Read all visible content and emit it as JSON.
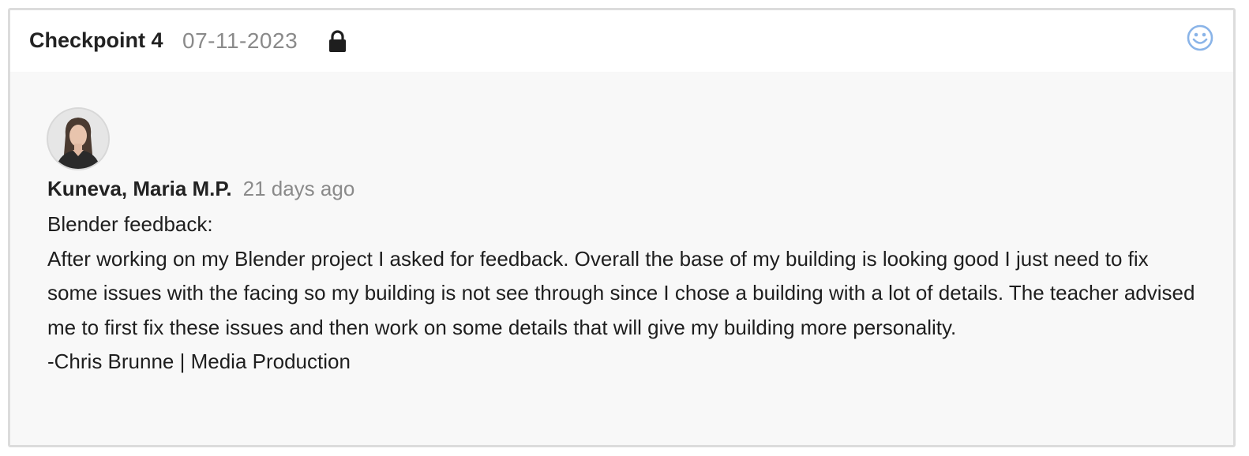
{
  "checkpoint": {
    "title": "Checkpoint 4",
    "date": "07-11-2023",
    "lock_icon": "lock-icon",
    "mood_icon": "smiley-icon",
    "mood_color": "#8ab4e8"
  },
  "comment": {
    "avatar_icon": "avatar",
    "author": "Kuneva, Maria M.P.",
    "time_ago": "21 days ago",
    "lines": [
      "Blender feedback:",
      "After working on my Blender project I asked for feedback. Overall the base of my building is looking good I just need to fix some issues with the facing so my building is not see through since I chose a building with a lot of details. The teacher advised me to first fix these issues and then work on some details that will give my building more personality.",
      "-Chris Brunne | Media Production"
    ]
  },
  "colors": {
    "border": "#dcdcdc",
    "body_bg": "#f8f8f8",
    "muted_text": "#8a8a8a",
    "text": "#222222"
  }
}
